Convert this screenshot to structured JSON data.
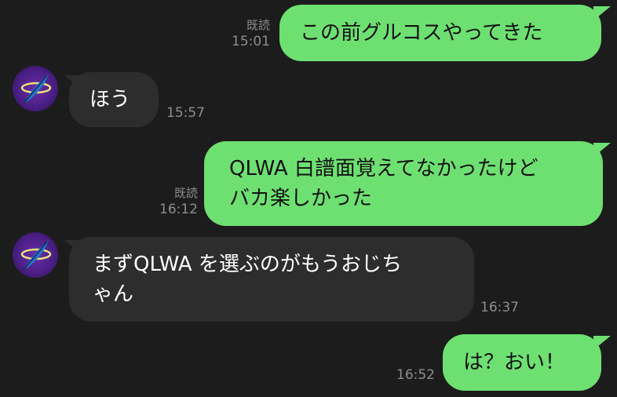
{
  "colors": {
    "background": "#1c1c1c",
    "outgoing_bubble": "#6ee072",
    "incoming_bubble": "#2d2d2d",
    "meta_text": "#8d8d8d"
  },
  "contact": {
    "avatar_icon": "feather-halo-avatar-icon"
  },
  "messages": [
    {
      "direction": "out",
      "text": "この前グルコスやってきた",
      "read": "既読",
      "time": "15:01"
    },
    {
      "direction": "in",
      "text": "ほう",
      "time": "15:57"
    },
    {
      "direction": "out",
      "lines": [
        "QLWA 白譜面覚えてなかったけど",
        "バカ楽しかった"
      ],
      "read": "既読",
      "time": "16:12"
    },
    {
      "direction": "in",
      "lines": [
        "まずQLWA を選ぶのがもうおじち",
        "ゃん"
      ],
      "time": "16:37"
    },
    {
      "direction": "out",
      "text": "は？おい！",
      "time": "16:52"
    }
  ]
}
